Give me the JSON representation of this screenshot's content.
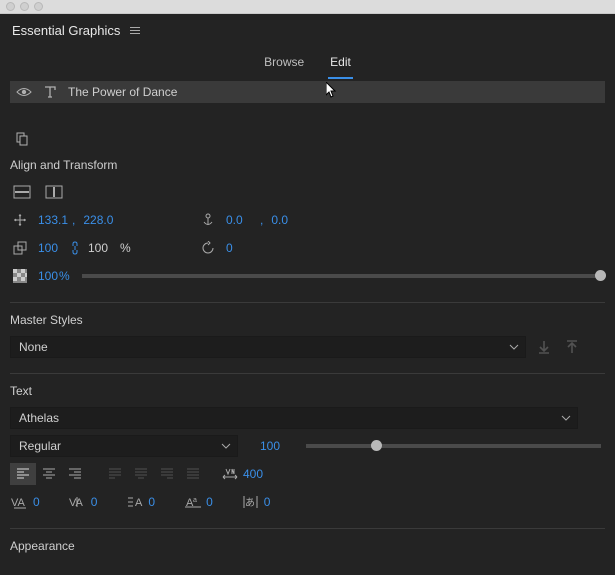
{
  "panel": {
    "title": "Essential Graphics"
  },
  "tabs": {
    "browse": "Browse",
    "edit": "Edit"
  },
  "layer": {
    "name": "The Power of Dance"
  },
  "sections": {
    "align": "Align and Transform",
    "master": "Master Styles",
    "text": "Text",
    "appearance": "Appearance"
  },
  "transform": {
    "pos_x": "133.1",
    "pos_sep": ",",
    "pos_y": "228.0",
    "anchor_x": "0.0",
    "anchor_sep": ",",
    "anchor_y": "0.0",
    "scale_w": "100",
    "scale_h": "100",
    "scale_unit": "%",
    "rotate": "0",
    "opacity_val": "100",
    "opacity_unit": "%"
  },
  "master": {
    "selected": "None"
  },
  "text": {
    "font": "Athelas",
    "weight": "Regular",
    "size": "100",
    "tracking": "400",
    "kerning": "0",
    "kerning2": "0",
    "leading": "0",
    "baseline": "0",
    "tsume": "0"
  }
}
